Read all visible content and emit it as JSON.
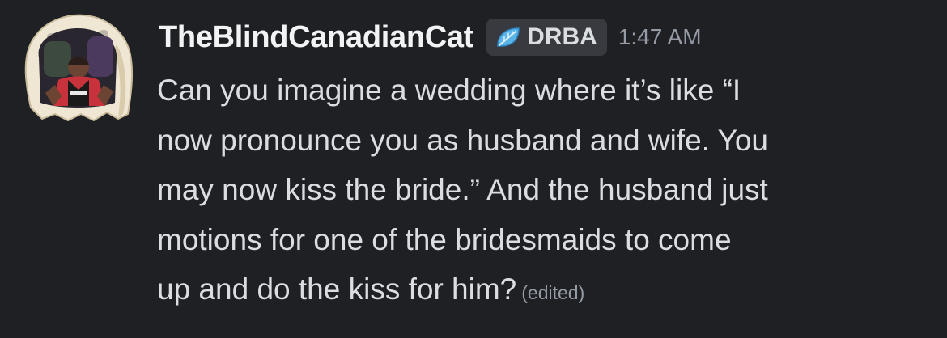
{
  "message": {
    "author": {
      "username": "TheBlindCanadianCat",
      "avatar_icon": "ghost-jersey-avatar",
      "tag": {
        "icon": "leaf-icon",
        "label": "DRBA"
      }
    },
    "timestamp": "1:47 AM",
    "content_lines": [
      "Can you imagine a wedding where it’s like “I",
      "now pronounce you as husband and wife. You",
      "may now kiss the bride.” And the husband just",
      "motions for one of the bridesmaids to come",
      "up and do the kiss for him?"
    ],
    "edited_label": "(edited)"
  },
  "colors": {
    "background": "#1f2024",
    "username": "#f2f3f5",
    "text": "#dbdee1",
    "muted": "#949ba4",
    "tag_background": "#383a40",
    "tag_icon": "#5ab4e8"
  }
}
